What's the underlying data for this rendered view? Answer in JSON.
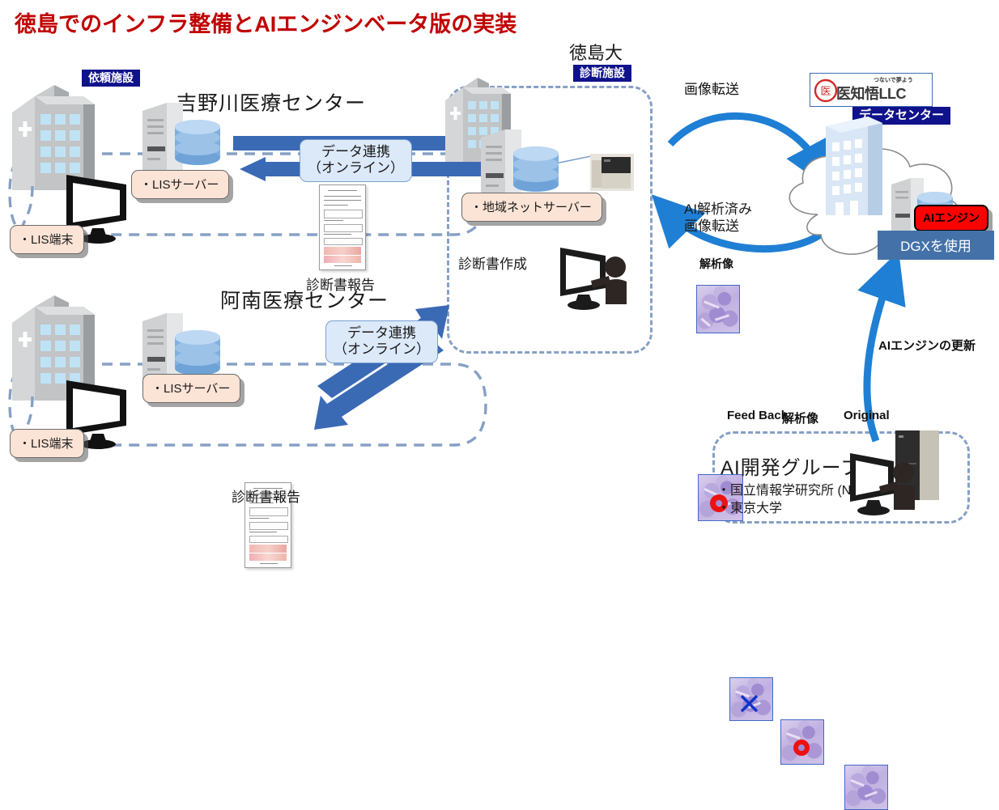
{
  "title": "徳島でのインフラ整備とAIエンジンベータ版の実装",
  "facilities": {
    "requesting_badge": "依頼施設",
    "diagnostic_badge": "診断施設",
    "tokushima_univ": "徳島大",
    "yoshinogawa": "吉野川医療センター",
    "anan": "阿南医療センター"
  },
  "nodes": {
    "lis_server": "・LISサーバー",
    "lis_terminal": "・LIS端末",
    "regional_net_server": "・地域ネットサーバー"
  },
  "links": {
    "data_link_line1": "データ連携",
    "data_link_line2": "（オンライン）"
  },
  "captions": {
    "report_top": "診断書報告",
    "report_bottom": "診断書報告",
    "create_report": "診断書作成",
    "image_transfer": "画像転送",
    "ai_analyzed_line1": "AI解析済み",
    "ai_analyzed_line2": "画像転送",
    "ai_engine_update": "AIエンジンの更新"
  },
  "datacenter": {
    "logo_tagline": "つないで夢よう",
    "logo_name": "医知悟LLC",
    "logo_seal": "医知悟",
    "badge": "データセンター",
    "ai_engine_badge": "AIエンジン",
    "dgx_bar": "DGXを使用"
  },
  "ai_group": {
    "title": "AI開発グループ",
    "member1": "・国立情報学研究所 (NII)",
    "member2": "・東京大学",
    "thumb_feedback": "Feed Back",
    "thumb_analysis": "解析像",
    "thumb_original": "Original"
  },
  "thumbnails": {
    "transfer_image_label": "",
    "analysis_image_label": "解析像"
  },
  "colors": {
    "title_red": "#c00000",
    "badge_navy": "#10128c",
    "arrow_blue": "#3b6ab5",
    "curve_blue": "#1f7fd4",
    "peach": "#fbe3d6",
    "dashed_blue": "#87a0c4",
    "ai_red": "#ff0000",
    "dgx_blue": "#4472a8"
  }
}
